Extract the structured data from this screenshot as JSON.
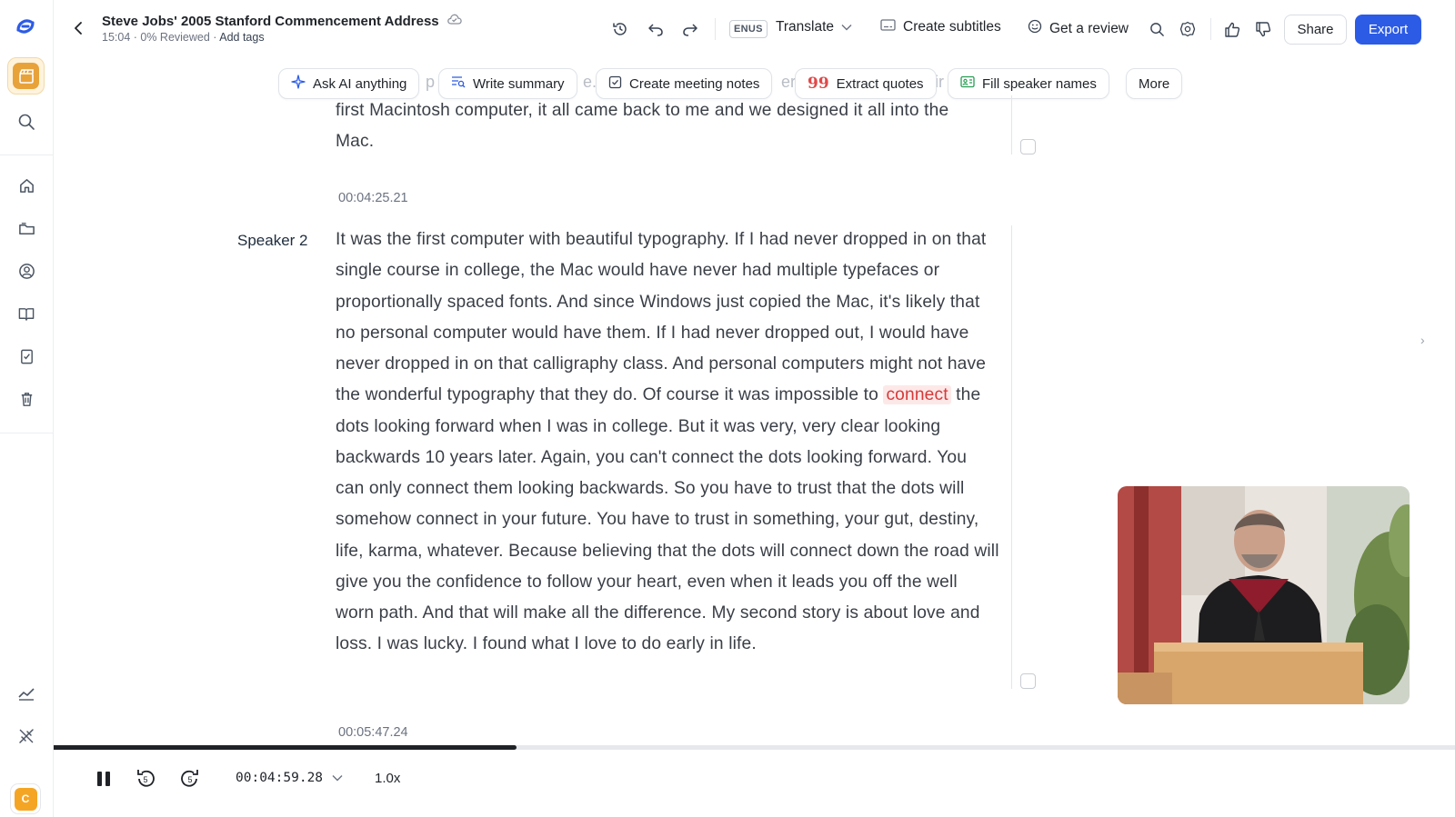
{
  "app": {
    "title": "Steve Jobs' 2005 Stanford Commencement Address",
    "meta": "15:04 · 0% Reviewed · ",
    "add_tags": "Add tags",
    "avatar_letter": "C"
  },
  "toolbar": {
    "lang_badge": "ENUS",
    "translate": "Translate",
    "create_subtitles": "Create subtitles",
    "get_review": "Get a review",
    "share": "Share",
    "export": "Export"
  },
  "ai_actions": [
    {
      "label": "Ask AI anything",
      "icon": "sparkle-icon"
    },
    {
      "label": "Write summary",
      "icon": "summary-icon"
    },
    {
      "label": "Create meeting notes",
      "icon": "checkbox-icon"
    },
    {
      "label": "Extract quotes",
      "icon": "quote-icon"
    },
    {
      "label": "Fill speaker names",
      "icon": "speaker-card-icon"
    },
    {
      "label": "More",
      "icon": ""
    }
  ],
  "transcript": {
    "prev_block_text": "first Macintosh computer, it all came back to me and we designed it all into the Mac.",
    "timestamp_1": "00:04:25.21",
    "speaker": "Speaker 2",
    "block_before": "It was the first computer with beautiful typography. If I had never dropped in on that single course in college, the Mac would have never had multiple typefaces or proportionally spaced fonts. And since Windows just copied the Mac, it's likely that no personal computer would have them. If I had never dropped out, I would have never dropped in on that calligraphy class. And personal computers might not have the wonderful typography that they do. Of course it was impossible to ",
    "highlight": "connect",
    "block_after": " the dots looking forward when I was in college. But it was very, very clear looking backwards 10 years later. Again, you can't connect the dots looking forward. You can only connect them looking backwards. So you have to trust that the dots will somehow connect in your future. You have to trust in something, your gut, destiny, life, karma, whatever. Because believing that the dots will connect down the road will give you the confidence to follow your heart, even when it leads you off the well worn path. And that will make all the difference. My second story is about love and loss. I was lucky. I found what I love to do early in life.",
    "timestamp_2": "00:05:47.24"
  },
  "player": {
    "current_time": "00:04:59.28",
    "speed": "1.0x",
    "progress": 0.33,
    "skip_back_seconds": "5",
    "skip_forward_seconds": "5"
  },
  "colors": {
    "accent": "#2c5be5",
    "highlight_bg": "#fde8e8",
    "highlight_text": "#d43a3a",
    "workspace": "#e8a23a"
  }
}
